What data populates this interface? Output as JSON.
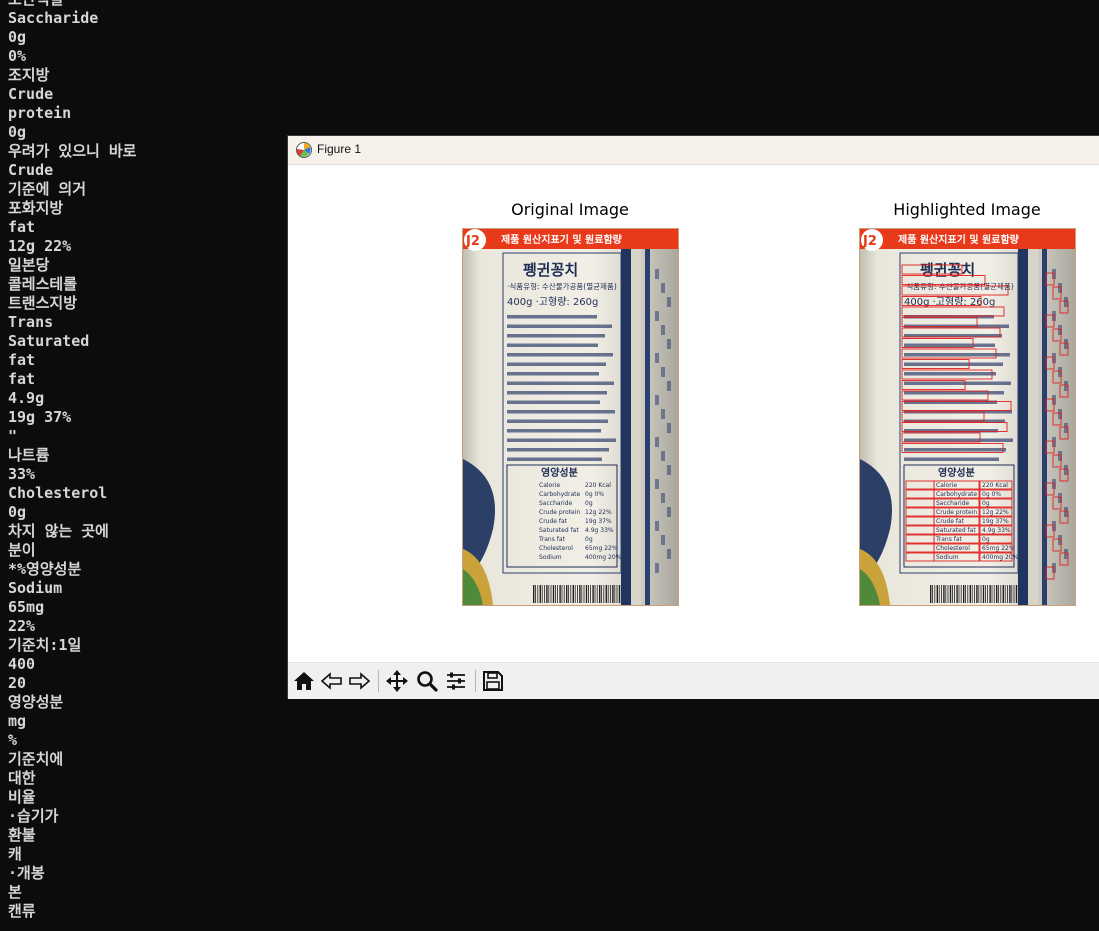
{
  "terminal": {
    "lines": [
      "조단백질",
      "Saccharide",
      "0g",
      "0%",
      "조지방",
      "Crude",
      "protein",
      "0g",
      "우려가 있으니 바로",
      "Crude",
      "기준에 의거",
      "포화지방",
      "fat",
      "12g 22%",
      "일본당",
      "콜레스테롤",
      "트랜스지방",
      "Trans",
      "Saturated",
      "fat",
      "fat",
      "4.9g",
      "19g 37%",
      "\"",
      "나트륨",
      "33%",
      "Cholesterol",
      "0g",
      "차지 않는 곳에",
      "분이",
      "*%영양성분",
      "Sodium",
      "65mg",
      "22%",
      "기준치:1일",
      "400",
      "20",
      "영양성분",
      "mg",
      "%",
      "기준치에",
      "대한",
      "비율",
      "·습기가",
      "환불",
      "캐",
      "·개봉",
      "본",
      "캔류"
    ]
  },
  "window": {
    "title": "Figure 1"
  },
  "figure": {
    "left_title": "Original Image",
    "right_title": "Highlighted Image",
    "label": {
      "brand": "J2",
      "banner": "제품 원산지표기 및 원료함량",
      "product": "펭귄꽁치",
      "type": "·식품유형: 수산물가공품(멸균제품)",
      "weight": "400g ·고형량: 260g",
      "nutrition_title": "영양성분",
      "rows": [
        [
          "Calorie",
          "220 Kcal"
        ],
        [
          "Carbohydrate",
          "0g  0%"
        ],
        [
          "Saccharide",
          "0g"
        ],
        [
          "Crude protein",
          "12g 22%"
        ],
        [
          "Crude fat",
          "19g 37%"
        ],
        [
          "Saturated fat",
          "4.9g 33%"
        ],
        [
          "Trans fat",
          "0g"
        ],
        [
          "Cholesterol",
          "65mg 22%"
        ],
        [
          "Sodium",
          "400mg 20%"
        ]
      ]
    }
  },
  "toolbar": {
    "items": [
      "home-icon",
      "back-icon",
      "forward-icon",
      "pan-icon",
      "zoom-icon",
      "configure-icon",
      "save-icon"
    ]
  },
  "colors": {
    "terminal_bg": "#0c0c0c",
    "terminal_fg": "#d6d6d6",
    "banner": "#e8391a",
    "highlight_box": "#e02020"
  }
}
